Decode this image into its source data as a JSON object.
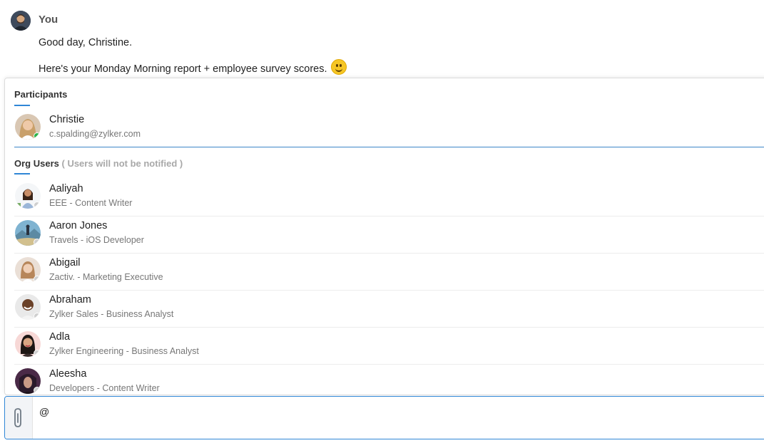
{
  "message": {
    "sender": "You",
    "lines": [
      "Good day, Christine.",
      "Here's your Monday Morning report + employee survey scores."
    ],
    "emoji": "smiley-emoji-icon"
  },
  "popup": {
    "participants_title": "Participants",
    "participants": [
      {
        "name": "Christie",
        "subtitle": "c.spalding@zylker.com",
        "status": "online"
      }
    ],
    "org_title": "Org Users",
    "org_note": "( Users will not be notified )",
    "org_users": [
      {
        "name": "Aaliyah",
        "subtitle": "EEE - Content Writer",
        "status": "offline"
      },
      {
        "name": "Aaron Jones",
        "subtitle": "Travels - iOS Developer",
        "status": "offline"
      },
      {
        "name": "Abigail",
        "subtitle": "Zactiv. - Marketing Executive",
        "status": "offline"
      },
      {
        "name": "Abraham",
        "subtitle": "Zylker Sales - Business Analyst",
        "status": "offline"
      },
      {
        "name": "Adla",
        "subtitle": "Zylker Engineering - Business Analyst",
        "status": "offline"
      },
      {
        "name": "Aleesha",
        "subtitle": "Developers - Content Writer",
        "status": "offline"
      }
    ]
  },
  "composer": {
    "value": "@",
    "attach_icon": "paperclip-icon"
  },
  "colors": {
    "accent": "#2f86d6",
    "online": "#2db34a",
    "offline": "#cfcfcf"
  }
}
